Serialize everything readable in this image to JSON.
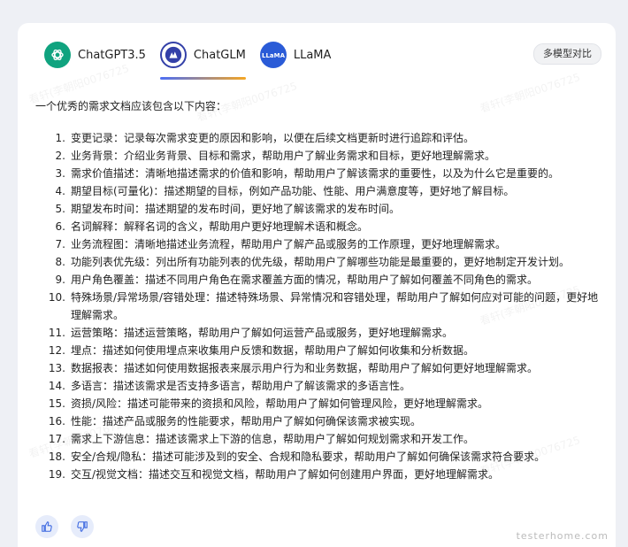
{
  "tabs": [
    {
      "label": "ChatGPT3.5",
      "icon": "openai-logo-icon"
    },
    {
      "label": "ChatGLM",
      "icon": "chatglm-logo-icon"
    },
    {
      "label": "LLaMA",
      "icon": "llama-logo-icon",
      "logo_text": "LLaMA"
    }
  ],
  "active_tab": "ChatGLM",
  "compare_button": "多模型对比",
  "answer": {
    "intro": "一个优秀的需求文档应该包含以下内容：",
    "items": [
      {
        "num": "1.",
        "text": "变更记录：记录每次需求变更的原因和影响，以便在后续文档更新时进行追踪和评估。"
      },
      {
        "num": "2.",
        "text": "业务背景：介绍业务背景、目标和需求，帮助用户了解业务需求和目标，更好地理解需求。"
      },
      {
        "num": "3.",
        "text": "需求价值描述：清晰地描述需求的价值和影响，帮助用户了解该需求的重要性，以及为什么它是重要的。"
      },
      {
        "num": "4.",
        "text": "期望目标(可量化)：描述期望的目标，例如产品功能、性能、用户满意度等，更好地了解目标。"
      },
      {
        "num": "5.",
        "text": "期望发布时间：描述期望的发布时间，更好地了解该需求的发布时间。"
      },
      {
        "num": "6.",
        "text": "名词解释：解释名词的含义，帮助用户更好地理解术语和概念。"
      },
      {
        "num": "7.",
        "text": "业务流程图：清晰地描述业务流程，帮助用户了解产品或服务的工作原理，更好地理解需求。"
      },
      {
        "num": "8.",
        "text": "功能列表优先级：列出所有功能列表的优先级，帮助用户了解哪些功能是最重要的，更好地制定开发计划。"
      },
      {
        "num": "9.",
        "text": "用户角色覆盖：描述不同用户角色在需求覆盖方面的情况，帮助用户了解如何覆盖不同角色的需求。"
      },
      {
        "num": "10.",
        "text": "特殊场景/异常场景/容错处理：描述特殊场景、异常情况和容错处理，帮助用户了解如何应对可能的问题，更好地理解需求。"
      },
      {
        "num": "11.",
        "text": "运营策略：描述运营策略，帮助用户了解如何运营产品或服务，更好地理解需求。"
      },
      {
        "num": "12.",
        "text": "埋点：描述如何使用埋点来收集用户反馈和数据，帮助用户了解如何收集和分析数据。"
      },
      {
        "num": "13.",
        "text": "数据报表：描述如何使用数据报表来展示用户行为和业务数据，帮助用户了解如何更好地理解需求。"
      },
      {
        "num": "14.",
        "text": "多语言：描述该需求是否支持多语言，帮助用户了解该需求的多语言性。"
      },
      {
        "num": "15.",
        "text": "资损/风险：描述可能带来的资损和风险，帮助用户了解如何管理风险，更好地理解需求。"
      },
      {
        "num": "16.",
        "text": "性能：描述产品或服务的性能要求，帮助用户了解如何确保该需求被实现。"
      },
      {
        "num": "17.",
        "text": "需求上下游信息：描述该需求上下游的信息，帮助用户了解如何规划需求和开发工作。"
      },
      {
        "num": "18.",
        "text": "安全/合规/隐私：描述可能涉及到的安全、合规和隐私要求，帮助用户了解如何确保该需求符合要求。"
      },
      {
        "num": "19.",
        "text": "交互/视觉文档：描述交互和视觉文档，帮助用户了解如何创建用户界面，更好地理解需求。"
      }
    ]
  },
  "feedback": {
    "like_icon": "thumbs-up-icon",
    "dislike_icon": "thumbs-down-icon"
  },
  "watermark": "看轩(李朝阳0076725",
  "footer_mark": "testerhome.com",
  "colors": {
    "accent": "#4c6ef5",
    "gpt": "#10a37f",
    "glm": "#3340a8",
    "llama": "#2a5bd7"
  }
}
